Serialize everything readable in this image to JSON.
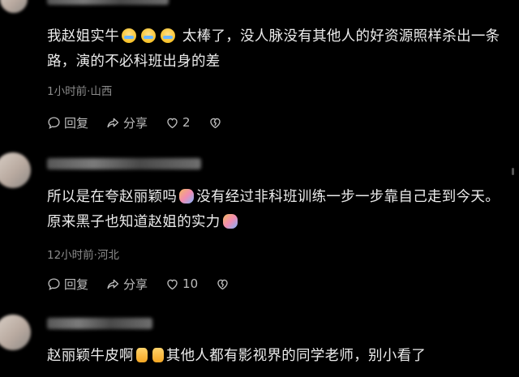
{
  "comments": [
    {
      "text_parts": [
        "我赵姐实牛",
        "太棒了，没人脉没有其他人的好资源照样杀出一条路，演的不必科班出身的差"
      ],
      "meta": "1小时前·山西",
      "reply_label": "回复",
      "share_label": "分享",
      "like_count": "2"
    },
    {
      "text_parts": [
        "所以是在夸赵丽颖吗",
        "没有经过非科班训练一步一步靠自己走到今天。原来黑子也知道赵姐的实力"
      ],
      "meta": "12小时前·河北",
      "reply_label": "回复",
      "share_label": "分享",
      "like_count": "10"
    },
    {
      "text_parts": [
        "赵丽颖牛皮啊",
        "其他人都有影视界的同学老师，别小看了"
      ]
    }
  ],
  "icons": {
    "reply": "comment-bubble-icon",
    "share": "share-arrow-icon",
    "like": "heart-icon",
    "dislike": "broken-heart-icon"
  },
  "colors": {
    "background": "#000000",
    "text": "#ececec",
    "meta": "#8c8c8c"
  }
}
